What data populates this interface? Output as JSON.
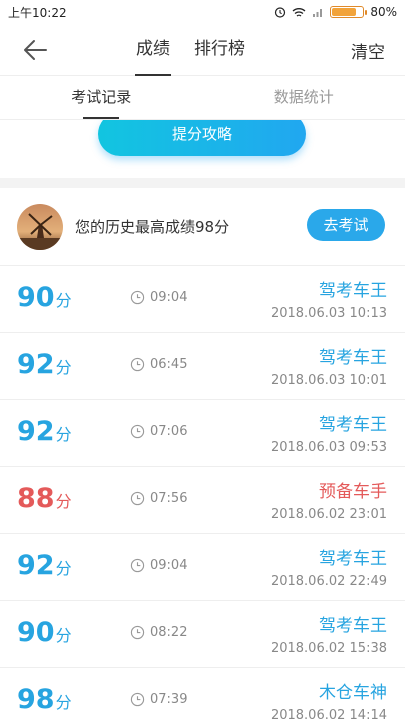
{
  "status": {
    "time": "上午10:22",
    "battery": "80%",
    "battery_level": 0.8
  },
  "nav": {
    "tabs": [
      "成绩",
      "排行榜"
    ],
    "active_tab": "成绩",
    "clear_label": "清空"
  },
  "subtabs": [
    "考试记录",
    "数据统计"
  ],
  "banner": {
    "button_label": "提分攻略"
  },
  "best": {
    "text": "您的历史最高成绩98分",
    "button_label": "去考试"
  },
  "records": [
    {
      "score": "90",
      "unit": "分",
      "duration": "09:04",
      "title": "驾考车王",
      "date": "2018.06.03  10:13",
      "color": "#27a4e0"
    },
    {
      "score": "92",
      "unit": "分",
      "duration": "06:45",
      "title": "驾考车王",
      "date": "2018.06.03  10:01",
      "color": "#27a4e0"
    },
    {
      "score": "92",
      "unit": "分",
      "duration": "07:06",
      "title": "驾考车王",
      "date": "2018.06.03  09:53",
      "color": "#27a4e0"
    },
    {
      "score": "88",
      "unit": "分",
      "duration": "07:56",
      "title": "预备车手",
      "date": "2018.06.02  23:01",
      "color": "#e45a5a"
    },
    {
      "score": "92",
      "unit": "分",
      "duration": "09:04",
      "title": "驾考车王",
      "date": "2018.06.02  22:49",
      "color": "#27a4e0"
    },
    {
      "score": "90",
      "unit": "分",
      "duration": "08:22",
      "title": "驾考车王",
      "date": "2018.06.02  15:38",
      "color": "#27a4e0"
    },
    {
      "score": "98",
      "unit": "分",
      "duration": "07:39",
      "title": "木仓车神",
      "date": "2018.06.02  14:14",
      "color": "#27a4e0"
    }
  ]
}
